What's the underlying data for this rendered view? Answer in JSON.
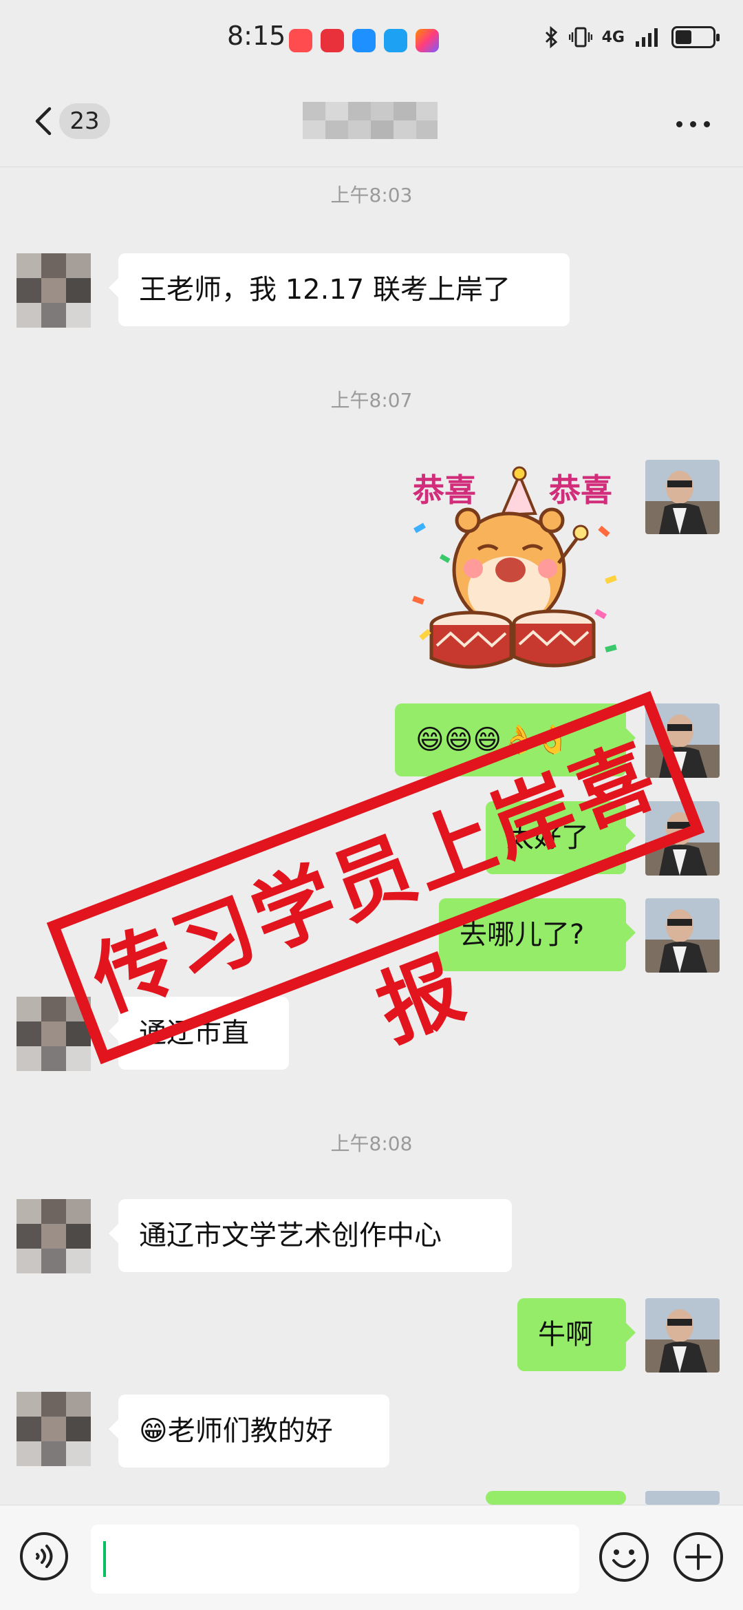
{
  "status_bar": {
    "time": "8:15",
    "network": "4G",
    "battery_level": 0.45,
    "app_icon_colors": [
      "#ff4d4f",
      "#e8313b",
      "#1e90ff",
      "#1da1f2",
      "#ff8a00"
    ]
  },
  "header": {
    "unread_count": "23"
  },
  "messages": [
    {
      "type": "timestamp",
      "text": "上午8:03"
    },
    {
      "type": "in",
      "text": "王老师，我 12.17 联考上岸了"
    },
    {
      "type": "timestamp",
      "text": "上午8:07"
    },
    {
      "type": "sticker",
      "text": "恭喜 恭喜",
      "left": "恭喜",
      "right": "恭喜"
    },
    {
      "type": "out",
      "text": "😄😄😄👌👌"
    },
    {
      "type": "out",
      "text": "太好了"
    },
    {
      "type": "out",
      "text": "去哪儿了?"
    },
    {
      "type": "in",
      "text": "通辽市直"
    },
    {
      "type": "timestamp",
      "text": "上午8:08"
    },
    {
      "type": "in",
      "text": "通辽市文学艺术创作中心"
    },
    {
      "type": "out",
      "text": "牛啊"
    },
    {
      "type": "in",
      "text": "😁老师们教的好"
    }
  ],
  "stamp": {
    "text": "传习学员上岸喜报",
    "color": "#e2141e"
  },
  "input_bar": {
    "value": ""
  },
  "colors": {
    "outgoing_bubble": "#95ec69",
    "incoming_bubble": "#ffffff",
    "background": "#ededed",
    "cursor": "#07c160"
  }
}
